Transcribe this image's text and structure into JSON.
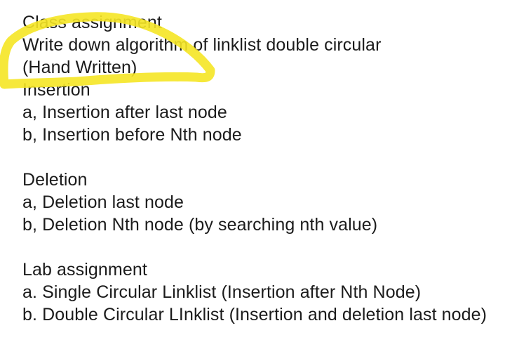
{
  "document": {
    "class_assignment": {
      "heading": "Class assignment",
      "task_line": "Write down algorithm of linklist double circular",
      "note": "(Hand Written)"
    },
    "insertion": {
      "heading": "Insertion",
      "items": [
        "a, Insertion after last node",
        "b, Insertion before Nth node"
      ]
    },
    "deletion": {
      "heading": "Deletion",
      "items": [
        "a, Deletion last node",
        "b, Deletion Nth node (by searching nth value)"
      ]
    },
    "lab_assignment": {
      "heading": "Lab assignment",
      "items": [
        "a. Single Circular Linklist (Insertion after Nth Node)",
        "b. Double Circular LInklist (Insertion and deletion last node)"
      ]
    }
  },
  "highlight": {
    "color": "#f5e625"
  }
}
